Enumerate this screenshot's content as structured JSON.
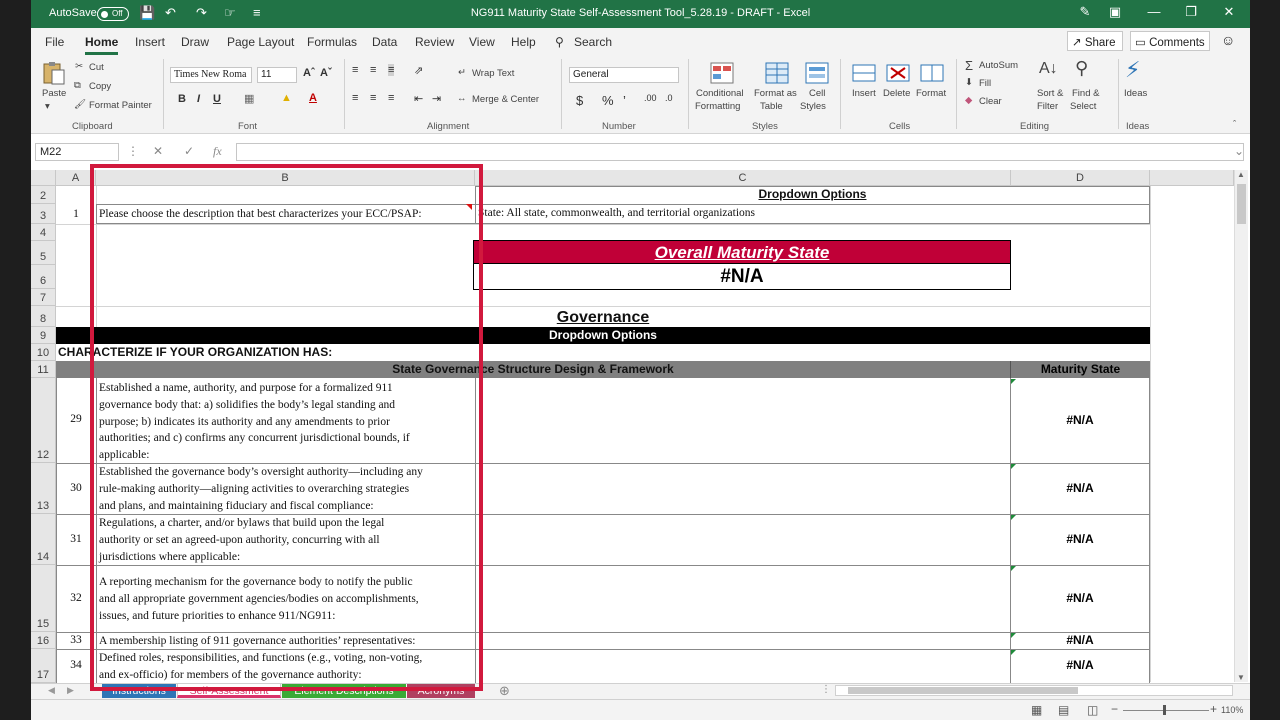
{
  "titlebar": {
    "autosave_label": "AutoSave",
    "autosave_state": "Off",
    "document_title": "NG911 Maturity State Self-Assessment Tool_5.28.19 - DRAFT  -  Excel"
  },
  "ribbon_tabs": [
    "File",
    "Home",
    "Insert",
    "Draw",
    "Page Layout",
    "Formulas",
    "Data",
    "Review",
    "View",
    "Help"
  ],
  "search_label": "Search",
  "share_label": "Share",
  "comments_label": "Comments",
  "clipboard": {
    "paste": "Paste",
    "cut": "Cut",
    "copy": "Copy",
    "format_painter": "Format Painter",
    "group": "Clipboard"
  },
  "font": {
    "name": "Times New Roma",
    "size": "11",
    "group": "Font"
  },
  "alignment": {
    "wrap_text": "Wrap Text",
    "merge_center": "Merge & Center",
    "group": "Alignment"
  },
  "number": {
    "format": "General",
    "group": "Number"
  },
  "styles": {
    "conditional": "Conditional",
    "conditional2": "Formatting",
    "format_as": "Format as",
    "format_as2": "Table",
    "cell": "Cell",
    "cell2": "Styles",
    "group": "Styles"
  },
  "cells": {
    "insert": "Insert",
    "delete": "Delete",
    "format": "Format",
    "group": "Cells"
  },
  "editing": {
    "autosum": "AutoSum",
    "fill": "Fill",
    "clear": "Clear",
    "sort": "Sort &",
    "sort2": "Filter",
    "find": "Find &",
    "find2": "Select",
    "group": "Editing"
  },
  "ideas": {
    "label": "Ideas",
    "group": "Ideas"
  },
  "formula_bar": {
    "name_box": "M22",
    "fx": "fx"
  },
  "columns": [
    "A",
    "B",
    "C",
    "D"
  ],
  "rows": {
    "r2": {
      "num": "2",
      "c": "Dropdown Options"
    },
    "r3": {
      "num": "3",
      "a": "1",
      "b": "Please choose the description that best characterizes your ECC/PSAP:",
      "c": "State: All state, commonwealth, and territorial organizations"
    },
    "r4": {
      "num": "4"
    },
    "r5": {
      "num": "5",
      "overall": "Overall Maturity State"
    },
    "r6": {
      "num": "6",
      "overall_value": "#N/A"
    },
    "r7": {
      "num": "7"
    },
    "r8": {
      "num": "8",
      "section": "Governance"
    },
    "r9": {
      "num": "9",
      "band": "Dropdown Options"
    },
    "r10": {
      "num": "10",
      "text": "CHARACTERIZE IF YOUR ORGANIZATION HAS:"
    },
    "r11": {
      "num": "11",
      "band": "State Governance Structure Design & Framework",
      "maturity": "Maturity State"
    }
  },
  "items": [
    {
      "row": "12",
      "a": "29",
      "text": [
        "Established a name, authority, and purpose for a formalized 911",
        "governance body that: a) solidifies the body’s legal standing and",
        "purpose; b) indicates its authority and any amendments to prior",
        "authorities; and c) confirms any concurrent jurisdictional bounds, if",
        "applicable:"
      ],
      "state": "#N/A"
    },
    {
      "row": "13",
      "a": "30",
      "text": [
        "Established the governance body’s oversight authority—including any",
        "rule-making authority—aligning activities to overarching strategies",
        "and plans, and maintaining fiduciary and fiscal compliance:"
      ],
      "state": "#N/A"
    },
    {
      "row": "14",
      "a": "31",
      "text": [
        "Regulations, a charter, and/or bylaws that build upon the legal",
        "authority or set an agreed-upon authority, concurring with all",
        "jurisdictions where applicable:"
      ],
      "state": "#N/A"
    },
    {
      "row": "15",
      "a": "32",
      "text": [
        "A reporting mechanism for the governance body to notify the public",
        "and all appropriate government agencies/bodies on accomplishments,",
        "issues, and future priorities to enhance 911/NG911:"
      ],
      "state": "#N/A"
    },
    {
      "row": "16",
      "a": "33",
      "text": [
        "A membership listing of 911 governance authorities’ representatives:"
      ],
      "state": "#N/A"
    },
    {
      "row": "17",
      "a": "34",
      "text": [
        "Defined roles, responsibilities, and functions (e.g., voting, non-voting,",
        "and ex-officio) for members of the governance authority:"
      ],
      "state": "#N/A"
    }
  ],
  "sheet_tabs": [
    {
      "label": "Instructions",
      "color": "#2e75b6"
    },
    {
      "label": "Self-Assessment",
      "color": "#d9346a"
    },
    {
      "label": "Element Descriptions",
      "color": "#3aaa35"
    },
    {
      "label": "Acronyms",
      "color": "#b04060"
    }
  ],
  "status": {
    "zoom": "110%"
  },
  "colors": {
    "excel_green": "#217346",
    "highlight_red": "#d1193d",
    "overall_banner": "#c00037"
  }
}
